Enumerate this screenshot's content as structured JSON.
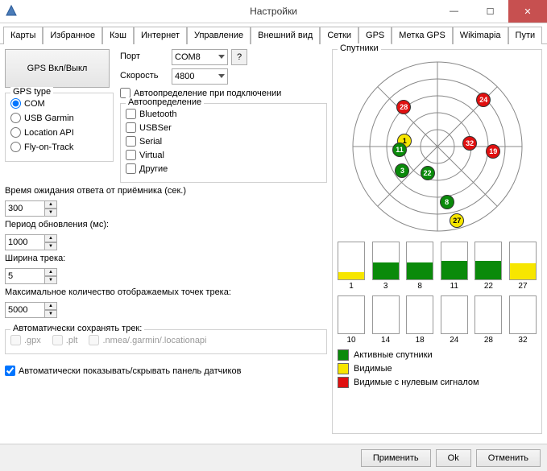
{
  "window": {
    "title": "Настройки"
  },
  "tabs": [
    "Карты",
    "Избранное",
    "Кэш",
    "Интернет",
    "Управление",
    "Внешний вид",
    "Сетки",
    "GPS",
    "Метка GPS",
    "Wikimapia",
    "Пути"
  ],
  "active_tab": 7,
  "gps": {
    "toggle_label": "GPS Вкл/Выкл",
    "type_group": "GPS type",
    "types": [
      "COM",
      "USB Garmin",
      "Location API",
      "Fly-on-Track"
    ],
    "type_selected": 0,
    "port_label": "Порт",
    "port_value": "COM8",
    "port_help": "?",
    "speed_label": "Скорость",
    "speed_value": "4800",
    "autodetect_on_connect": "Автоопределение при подключении",
    "autodetect_group": "Автоопределение",
    "autodetect_opts": [
      "Bluetooth",
      "USBSer",
      "Serial",
      "Virtual",
      "Другие"
    ],
    "timeout_label": "Время ожидания ответа от приёмника (сек.)",
    "timeout_value": "300",
    "period_label": "Период обновления (мс):",
    "period_value": "1000",
    "width_label": "Ширина трека:",
    "width_value": "5",
    "maxpts_label": "Максимальное количество отображаемых точек трека:",
    "maxpts_value": "5000",
    "autosave_group": "Автоматически сохранять трек:",
    "autosave_opts": [
      ".gpx",
      ".plt",
      ".nmea/.garmin/.locationapi"
    ],
    "autoshow": "Автоматически показывать/скрывать панель датчиков"
  },
  "sat": {
    "group": "Спутники",
    "legend_active": "Активные спутники",
    "legend_visible": "Видимые",
    "legend_zero": "Видимые с нулевым сигналом",
    "colors": {
      "active": "#0a8a0a",
      "visible": "#f7e600",
      "zero": "#e01010"
    }
  },
  "chart_data": {
    "type": "bar",
    "skyplot": [
      {
        "id": 24,
        "az": 45,
        "el": 20,
        "status": "zero"
      },
      {
        "id": 28,
        "az": 320,
        "el": 35,
        "status": "zero"
      },
      {
        "id": 19,
        "az": 95,
        "el": 30,
        "status": "zero"
      },
      {
        "id": 1,
        "az": 280,
        "el": 55,
        "status": "visible"
      },
      {
        "id": 11,
        "az": 265,
        "el": 50,
        "status": "active"
      },
      {
        "id": 32,
        "az": 85,
        "el": 55,
        "status": "zero"
      },
      {
        "id": 22,
        "az": 200,
        "el": 60,
        "status": "active"
      },
      {
        "id": 3,
        "az": 235,
        "el": 45,
        "status": "active"
      },
      {
        "id": 8,
        "az": 170,
        "el": 30,
        "status": "active"
      },
      {
        "id": 27,
        "az": 165,
        "el": 8,
        "status": "visible"
      }
    ],
    "bars_top": [
      {
        "id": 1,
        "level": 12,
        "status": "visible"
      },
      {
        "id": 3,
        "level": 28,
        "status": "active"
      },
      {
        "id": 8,
        "level": 28,
        "status": "active"
      },
      {
        "id": 11,
        "level": 30,
        "status": "active"
      },
      {
        "id": 22,
        "level": 30,
        "status": "active"
      },
      {
        "id": 27,
        "level": 26,
        "status": "visible"
      }
    ],
    "bars_bottom": [
      {
        "id": 10,
        "level": 0
      },
      {
        "id": 14,
        "level": 0
      },
      {
        "id": 18,
        "level": 0
      },
      {
        "id": 24,
        "level": 0
      },
      {
        "id": 28,
        "level": 0
      },
      {
        "id": 32,
        "level": 0
      }
    ],
    "bar_max": 60
  },
  "buttons": {
    "apply": "Применить",
    "ok": "Ok",
    "cancel": "Отменить"
  }
}
